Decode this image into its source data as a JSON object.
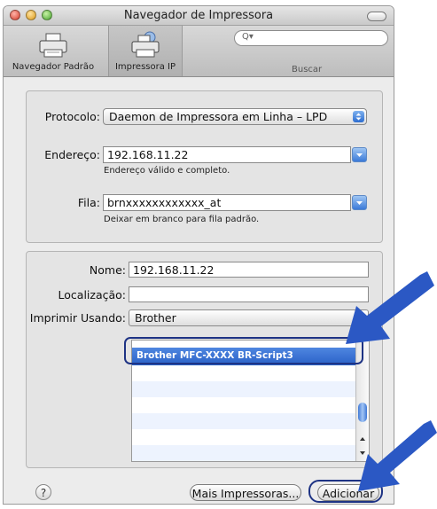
{
  "window": {
    "title": "Navegador de Impressora"
  },
  "toolbar": {
    "default_browser_label": "Navegador Padrão",
    "ip_printer_label": "Impressora IP",
    "search_label": "Buscar",
    "search_glyph": "Q▾"
  },
  "connection": {
    "protocol_label": "Protocolo:",
    "protocol_value": "Daemon de Impressora em Linha – LPD",
    "address_label": "Endereço:",
    "address_value": "192.168.11.22",
    "address_hint": "Endereço válido e completo.",
    "queue_label": "Fila:",
    "queue_value": "brnxxxxxxxxxxxx_at",
    "queue_hint": "Deixar em branco para fila padrão."
  },
  "details": {
    "name_label": "Nome:",
    "name_value": "192.168.11.22",
    "location_label": "Localização:",
    "location_value": "",
    "print_using_label": "Imprimir Usando:",
    "print_using_value": "Brother",
    "model_list": {
      "items": [
        {
          "label": "Brother MFC-XXXX BR-Script3",
          "selected": true
        }
      ]
    }
  },
  "buttons": {
    "help": "?",
    "more_printers": "Mais Impressoras...",
    "add": "Adicionar"
  },
  "colors": {
    "accent": "#3a72d4",
    "highlight": "#1e3384",
    "arrow": "#2b58c4"
  },
  "icons": [
    "printer-icon",
    "network-printer-icon",
    "search-icon",
    "stepper-arrows-icon",
    "dropdown-arrow-icon",
    "help-icon",
    "callout-arrow-icon"
  ]
}
